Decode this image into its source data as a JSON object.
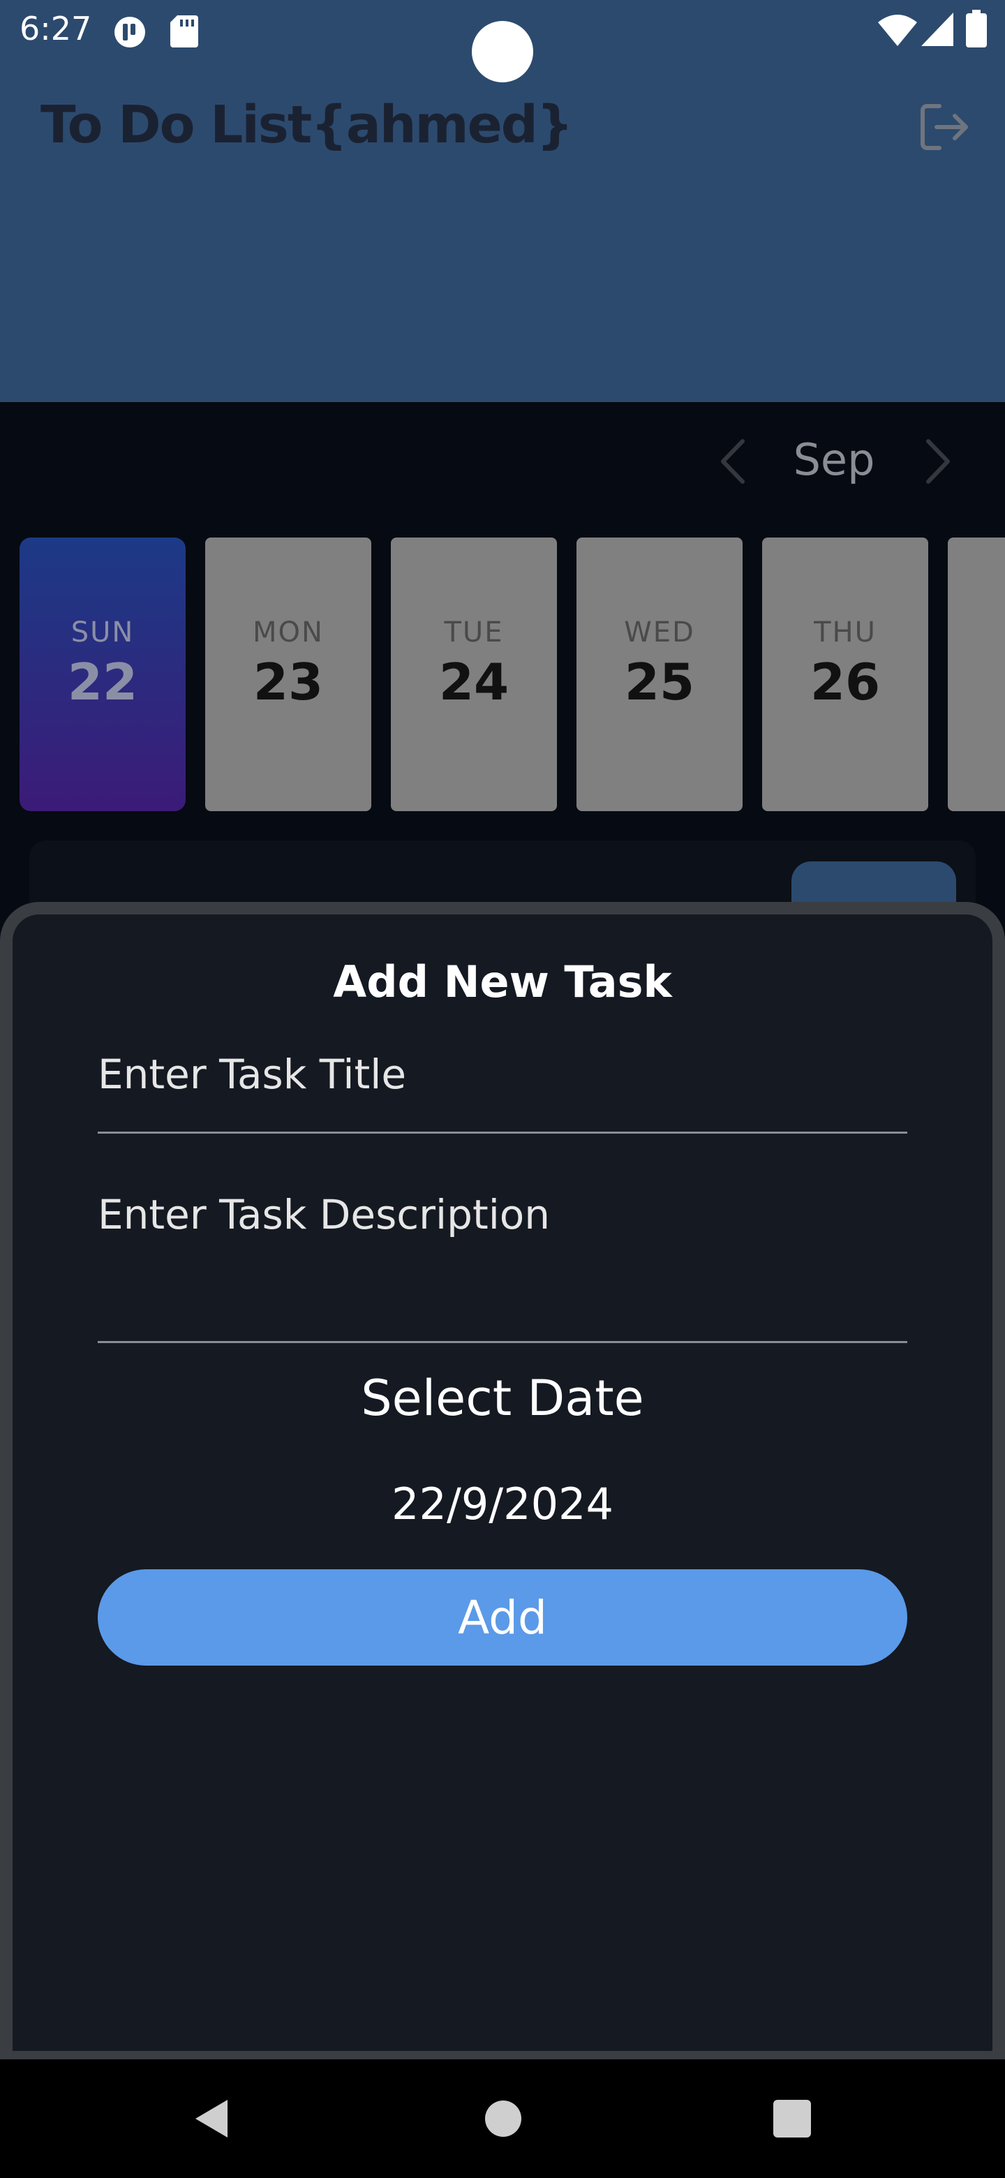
{
  "status_bar": {
    "time": "6:27"
  },
  "header": {
    "title": "To Do List{ahmed}"
  },
  "calendar": {
    "month_label": "Sep",
    "days": [
      {
        "name": "SUN",
        "number": "22",
        "selected": true
      },
      {
        "name": "MON",
        "number": "23",
        "selected": false
      },
      {
        "name": "TUE",
        "number": "24",
        "selected": false
      },
      {
        "name": "WED",
        "number": "25",
        "selected": false
      },
      {
        "name": "THU",
        "number": "26",
        "selected": false
      }
    ]
  },
  "sheet": {
    "title": "Add New Task",
    "task_title_placeholder": "Enter Task Title",
    "task_description_placeholder": "Enter Task Description",
    "select_date_label": "Select Date",
    "date_value": "22/9/2024",
    "add_label": "Add"
  },
  "colors": {
    "header_bg": "#2c4a6e",
    "sheet_bg": "#151922",
    "accent_button": "#5b9ae8",
    "day_card": "#808080"
  }
}
